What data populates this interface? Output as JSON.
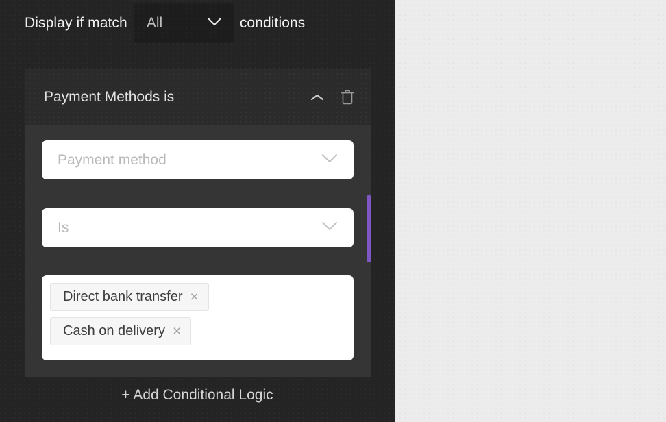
{
  "match_row": {
    "prefix_label": "Display if match",
    "selected": "All",
    "suffix_label": "conditions",
    "chevron_icon": "chevron-down-icon"
  },
  "condition": {
    "title": "Payment Methods is",
    "collapse_icon": "chevron-up-icon",
    "delete_icon": "trash-icon",
    "field_select": {
      "placeholder": "Payment method",
      "chevron_icon": "chevron-down-icon"
    },
    "operator_select": {
      "placeholder": "Is",
      "chevron_icon": "chevron-down-icon"
    },
    "value_chips": [
      {
        "label": "Direct bank transfer",
        "remove_icon": "close-icon",
        "remove_glyph": "×"
      },
      {
        "label": "Cash on delivery",
        "remove_icon": "close-icon",
        "remove_glyph": "×"
      }
    ]
  },
  "footer": {
    "add_label": "+ Add Conditional Logic"
  },
  "colors": {
    "panel_background": "#242424",
    "card_header": "#2b2b2b",
    "card_body": "#353535",
    "match_select_background": "#1d1d1d",
    "field_background": "#ffffff",
    "chip_background": "#f6f6f6",
    "scrollbar_accent": "#7e57c2",
    "canvas_background": "#ececec"
  }
}
